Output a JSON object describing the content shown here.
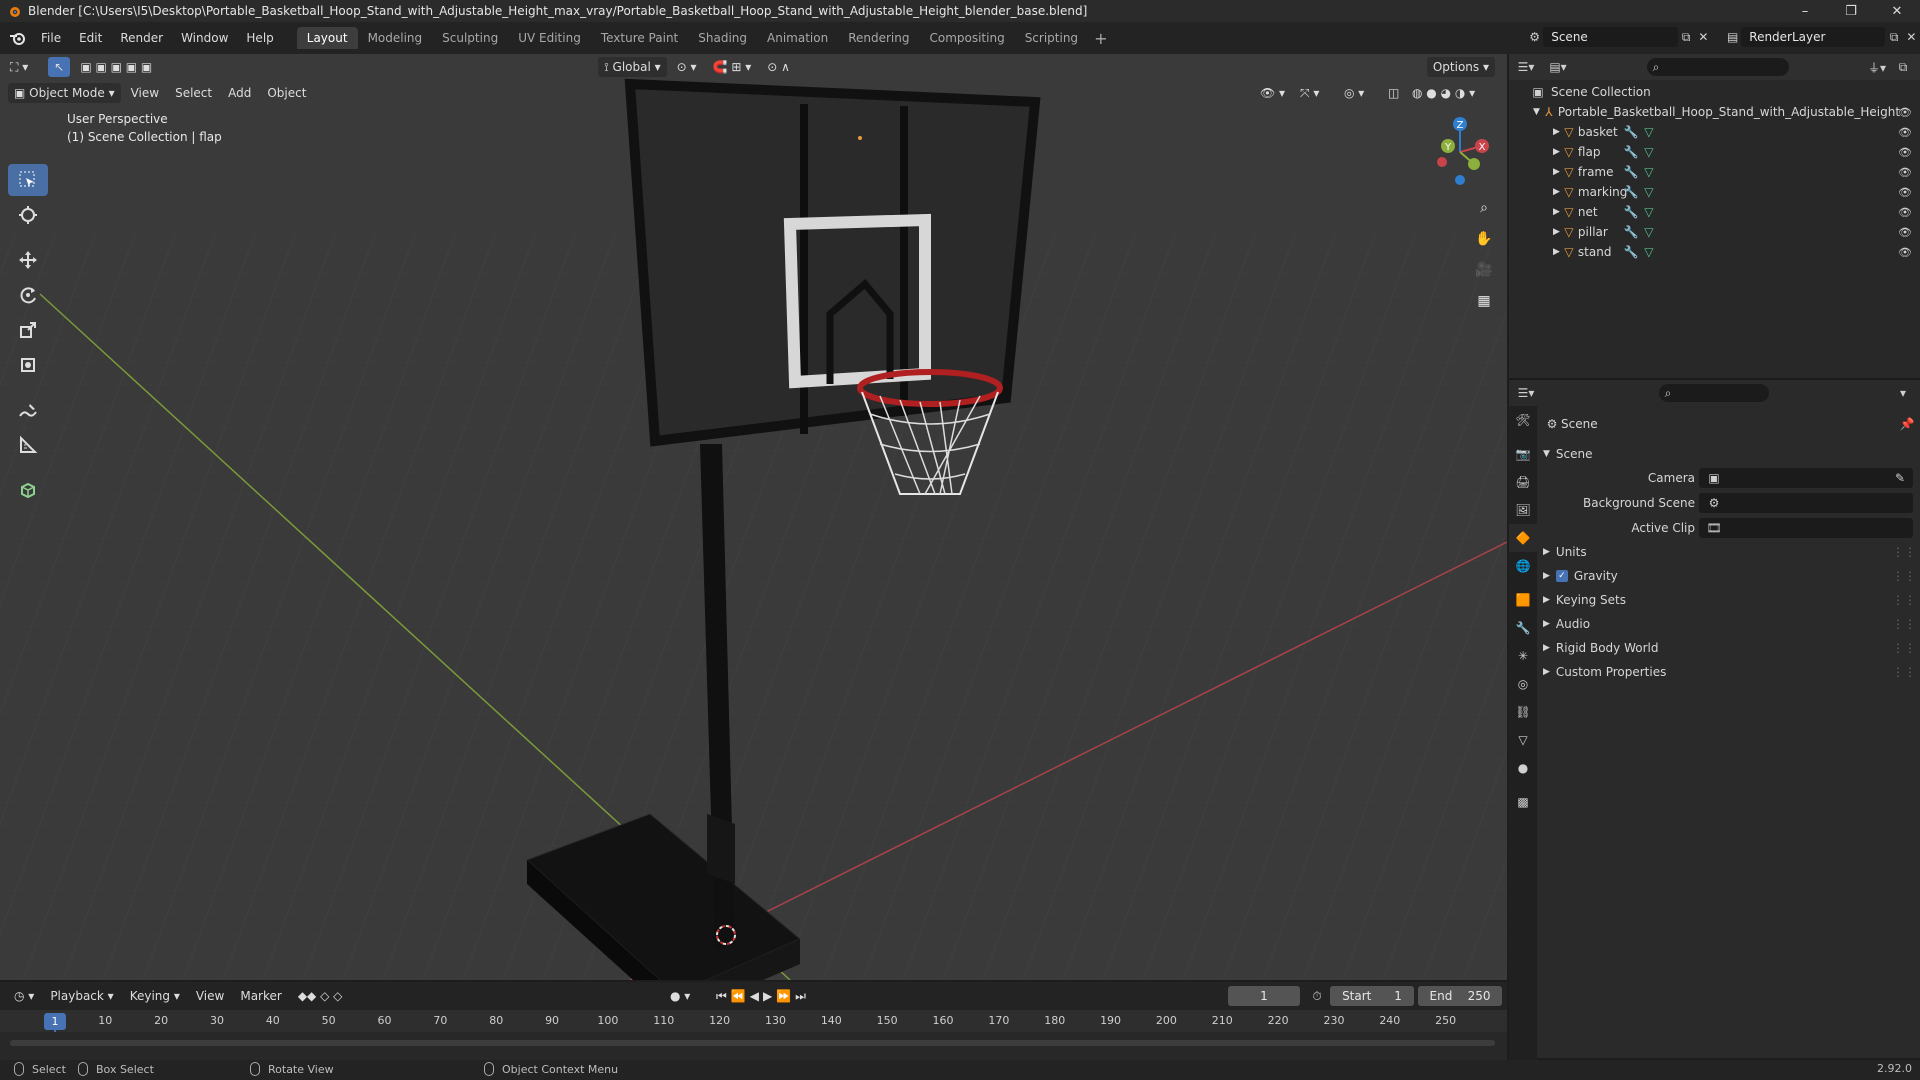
{
  "window": {
    "title": "Blender [C:\\Users\\I5\\Desktop\\Portable_Basketball_Hoop_Stand_with_Adjustable_Height_max_vray/Portable_Basketball_Hoop_Stand_with_Adjustable_Height_blender_base.blend]",
    "controls": [
      "–",
      "❐",
      "✕"
    ]
  },
  "menu": [
    "File",
    "Edit",
    "Render",
    "Window",
    "Help"
  ],
  "workspaces": [
    {
      "label": "Layout",
      "active": true
    },
    {
      "label": "Modeling"
    },
    {
      "label": "Sculpting"
    },
    {
      "label": "UV Editing"
    },
    {
      "label": "Texture Paint"
    },
    {
      "label": "Shading"
    },
    {
      "label": "Animation"
    },
    {
      "label": "Rendering"
    },
    {
      "label": "Compositing"
    },
    {
      "label": "Scripting"
    }
  ],
  "scene_selector": {
    "value": "Scene"
  },
  "view_layer_selector": {
    "value": "RenderLayer"
  },
  "viewport": {
    "mode": "Object Mode",
    "menus": [
      "View",
      "Select",
      "Add",
      "Object"
    ],
    "orientation": "Global",
    "options_label": "Options",
    "info_line1": "User Perspective",
    "info_line2": "(1) Scene Collection | flap",
    "gizmo_axes": [
      "X",
      "Y",
      "Z"
    ]
  },
  "outliner": {
    "root": "Scene Collection",
    "collection": "Portable_Basketball_Hoop_Stand_with_Adjustable_Height",
    "objects": [
      "basket",
      "flap",
      "frame",
      "marking",
      "net",
      "pillar",
      "stand"
    ]
  },
  "properties": {
    "context": "Scene",
    "panel_title": "Scene",
    "fields": {
      "camera_label": "Camera",
      "background_scene_label": "Background Scene",
      "active_clip_label": "Active Clip"
    },
    "subpanels": [
      {
        "label": "Units"
      },
      {
        "label": "Gravity",
        "checked": true
      },
      {
        "label": "Keying Sets"
      },
      {
        "label": "Audio"
      },
      {
        "label": "Rigid Body World"
      },
      {
        "label": "Custom Properties"
      }
    ]
  },
  "timeline": {
    "menus": [
      "Playback",
      "Keying",
      "View",
      "Marker"
    ],
    "current_frame": "1",
    "start_label": "Start",
    "start_value": "1",
    "end_label": "End",
    "end_value": "250",
    "ruler": [
      "10",
      "20",
      "30",
      "40",
      "50",
      "60",
      "70",
      "80",
      "90",
      "100",
      "110",
      "120",
      "130",
      "140",
      "150",
      "160",
      "170",
      "180",
      "190",
      "200",
      "210",
      "220",
      "230",
      "240",
      "250"
    ],
    "playhead_label": "1"
  },
  "statusbar": {
    "select": "Select",
    "box_select": "Box Select",
    "rotate_view": "Rotate View",
    "context_menu": "Object Context Menu",
    "version": "2.92.0"
  },
  "colors": {
    "accent": "#4772b3",
    "x_axis": "#c9444a",
    "y_axis": "#8cb03b",
    "z_axis": "#2f7fd0",
    "object_orange": "#e89a3c"
  }
}
